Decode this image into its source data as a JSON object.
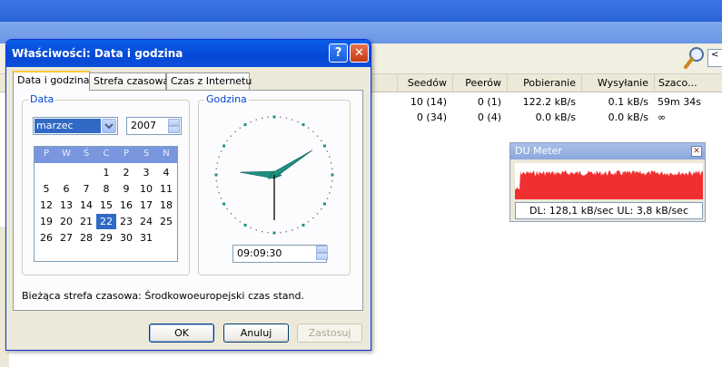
{
  "app": {
    "search_placeholder": "<",
    "columns": [
      "Seedów",
      "Peerów",
      "Pobieranie",
      "Wysyłanie",
      "Szaco..."
    ],
    "rows": [
      [
        "10 (14)",
        "0 (1)",
        "122.2 kB/s",
        "0.1 kB/s",
        "59m 34s"
      ],
      [
        "0 (34)",
        "0 (4)",
        "0.0 kB/s",
        "0.0 kB/s",
        "∞"
      ]
    ]
  },
  "du_meter": {
    "title": "DU Meter",
    "status": "DL: 128,1 kB/sec  UL: 3,8 kB/sec",
    "graph_color": "#f03030"
  },
  "dialog": {
    "title": "Właściwości: Data i godzina",
    "help_label": "?",
    "close_label": "✕",
    "tabs": [
      "Data i godzina",
      "Strefa czasowa",
      "Czas z Internetu"
    ],
    "active_tab": 0,
    "date_group_label": "Data",
    "time_group_label": "Godzina",
    "month": "marzec",
    "year": "2007",
    "weekday_headers": [
      "P",
      "W",
      "Ś",
      "C",
      "P",
      "S",
      "N"
    ],
    "calendar_days": [
      [
        "",
        "",
        "",
        "1",
        "2",
        "3",
        "4"
      ],
      [
        "5",
        "6",
        "7",
        "8",
        "9",
        "10",
        "11"
      ],
      [
        "12",
        "13",
        "14",
        "15",
        "16",
        "17",
        "18"
      ],
      [
        "19",
        "20",
        "21",
        "22",
        "23",
        "24",
        "25"
      ],
      [
        "26",
        "27",
        "28",
        "29",
        "30",
        "31",
        ""
      ]
    ],
    "selected_day": "22",
    "time_value": "09:09:30",
    "timezone_line": "Bieżąca strefa czasowa: Środkowoeuropejski czas stand.",
    "buttons": {
      "ok": "OK",
      "cancel": "Anuluj",
      "apply": "Zastosuj"
    }
  },
  "colors": {
    "title_blue": "#0648d6",
    "accent_link": "#0046d5",
    "selected_blue": "#316ac5",
    "hand_teal": "#1f8f80"
  }
}
